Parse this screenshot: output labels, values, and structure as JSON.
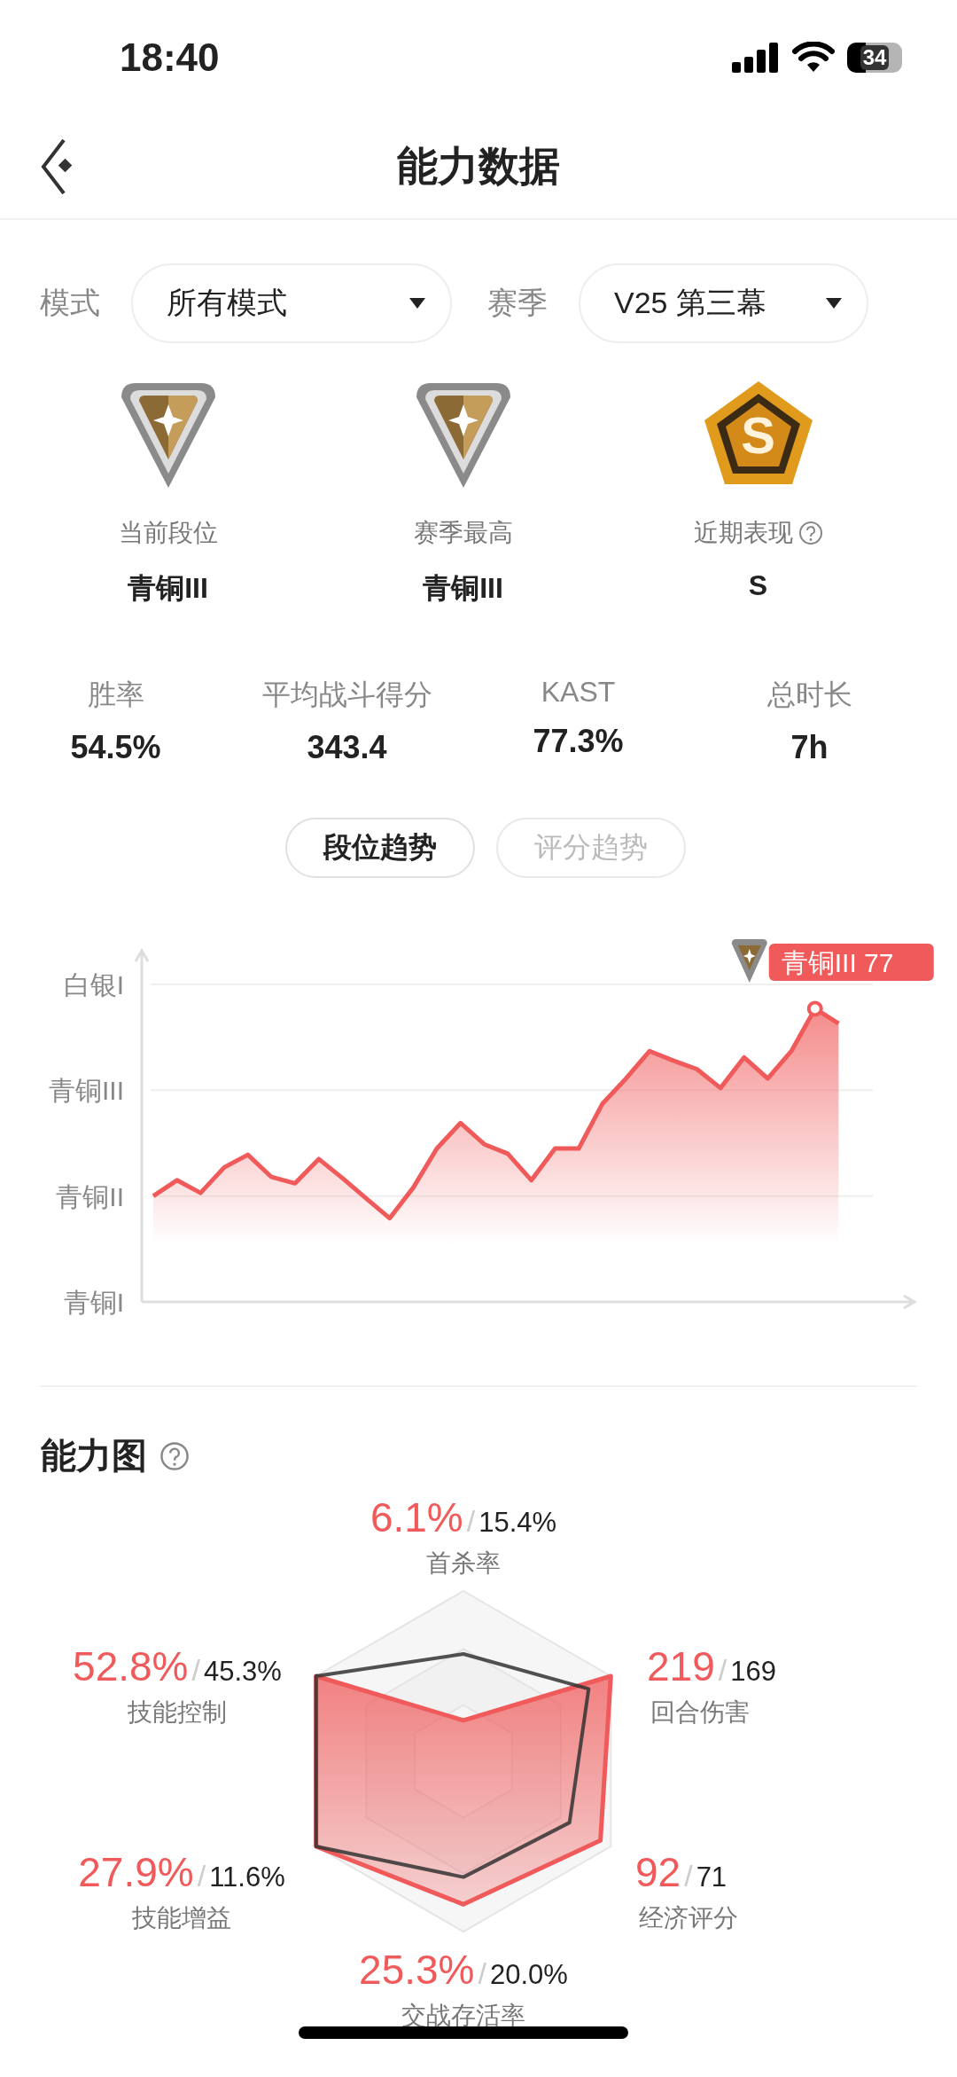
{
  "status_bar": {
    "time": "18:40",
    "battery": "34"
  },
  "header": {
    "title": "能力数据"
  },
  "filters": [
    {
      "label": "模式",
      "value": "所有模式"
    },
    {
      "label": "赛季",
      "value": "V25 第三幕"
    }
  ],
  "ranks": [
    {
      "kind": "rank",
      "label": "当前段位",
      "value": "青铜III",
      "help": false
    },
    {
      "kind": "rank",
      "label": "赛季最高",
      "value": "青铜III",
      "help": false
    },
    {
      "kind": "grade",
      "label": "近期表现",
      "value": "S",
      "badge": "S",
      "help": true
    }
  ],
  "stats": [
    {
      "label": "胜率",
      "value": "54.5%"
    },
    {
      "label": "平均战斗得分",
      "value": "343.4"
    },
    {
      "label": "KAST",
      "value": "77.3%"
    },
    {
      "label": "总时长",
      "value": "7h"
    }
  ],
  "tabs": [
    {
      "label": "段位趋势",
      "selected": true
    },
    {
      "label": "评分趋势",
      "selected": false
    }
  ],
  "trend": {
    "axis_labels": [
      "白银I",
      "青铜III",
      "青铜II",
      "青铜I"
    ],
    "tooltip": "青铜III 77"
  },
  "ability": {
    "title": "能力图",
    "help": true,
    "separator": "/",
    "axes": [
      {
        "value": "6.1%",
        "average": "15.4%",
        "label": "首杀率"
      },
      {
        "value": "52.8%",
        "average": "45.3%",
        "label": "技能控制"
      },
      {
        "value": "219",
        "average": "169",
        "label": "回合伤害"
      },
      {
        "value": "27.9%",
        "average": "11.6%",
        "label": "技能增益"
      },
      {
        "value": "92",
        "average": "71",
        "label": "经济评分"
      },
      {
        "value": "25.3%",
        "average": "20.0%",
        "label": "交战存活率"
      }
    ]
  }
}
